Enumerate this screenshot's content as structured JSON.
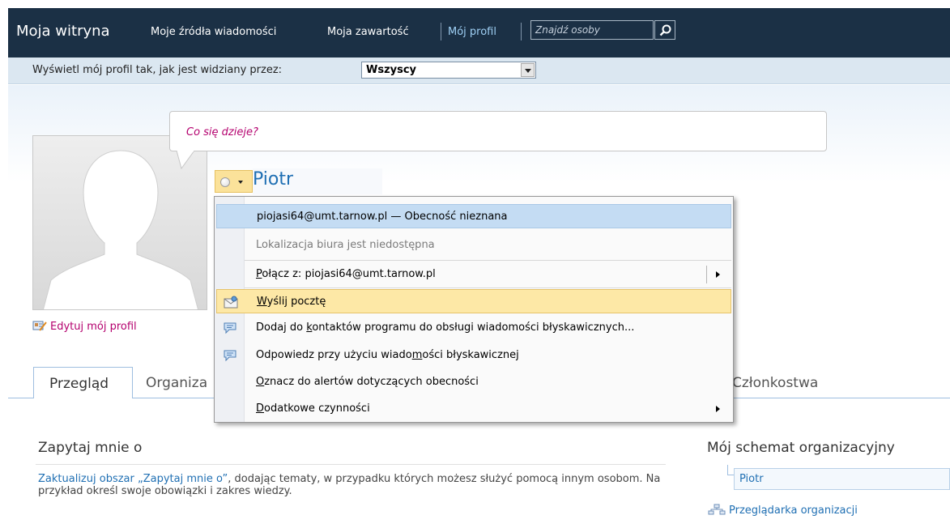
{
  "nav": {
    "site_title": "Moja witryna",
    "links": [
      "Moje źródła wiadomości",
      "Moja zawartość",
      "Mój profil"
    ],
    "search_placeholder": "Znajdź osoby"
  },
  "viewbar": {
    "label": "Wyświetl mój profil tak, jak jest widziany przez:",
    "selected": "Wszyscy"
  },
  "status": {
    "placeholder": "Co się dzieje?"
  },
  "profile": {
    "name": "Piotr",
    "edit_link": "Edytuj mój profil"
  },
  "tabs": {
    "active": "Przegląd",
    "items": [
      "Organiza",
      "Członkostwa"
    ]
  },
  "menu": {
    "header": "piojasi64@umt.tarnow.pl — Obecność nieznana",
    "office_location": "Lokalizacja biura jest niedostępna",
    "connect": {
      "pre": "",
      "accel": "P",
      "post": "ołącz z: piojasi64@umt.tarnow.pl"
    },
    "send_mail": {
      "pre": "",
      "accel": "W",
      "post": "yślij pocztę"
    },
    "add_contact": {
      "pre": "Dodaj do ",
      "accel": "k",
      "post": "ontaktów programu do obsługi wiadomości błyskawicznych..."
    },
    "reply_im": {
      "pre": "Odpowiedz przy użyciu wiado",
      "accel": "m",
      "post": "ości błyskawicznej"
    },
    "alert": {
      "pre": "",
      "accel": "O",
      "post": "znacz do alertów dotyczących obecności"
    },
    "more": {
      "pre": "",
      "accel": "D",
      "post": "odatkowe czynności"
    }
  },
  "ask": {
    "title": "Zapytaj mnie o",
    "link_text": "Zaktualizuj obszar „Zapytaj mnie o”",
    "rest_text": ", dodając tematy, w przypadku których możesz służyć pomocą innym osobom. Na przykład określ swoje obowiązki i zakres wiedzy."
  },
  "org": {
    "title": "Mój schemat organizacyjny",
    "node": "Piotr",
    "browser_link": "Przeglądarka organizacji"
  },
  "colors": {
    "nav_bg": "#1b3045",
    "link_blue": "#1f6fb3",
    "magenta": "#b4006e",
    "menu_hover": "#fde8a6",
    "menu_header": "#c4dcf3"
  }
}
